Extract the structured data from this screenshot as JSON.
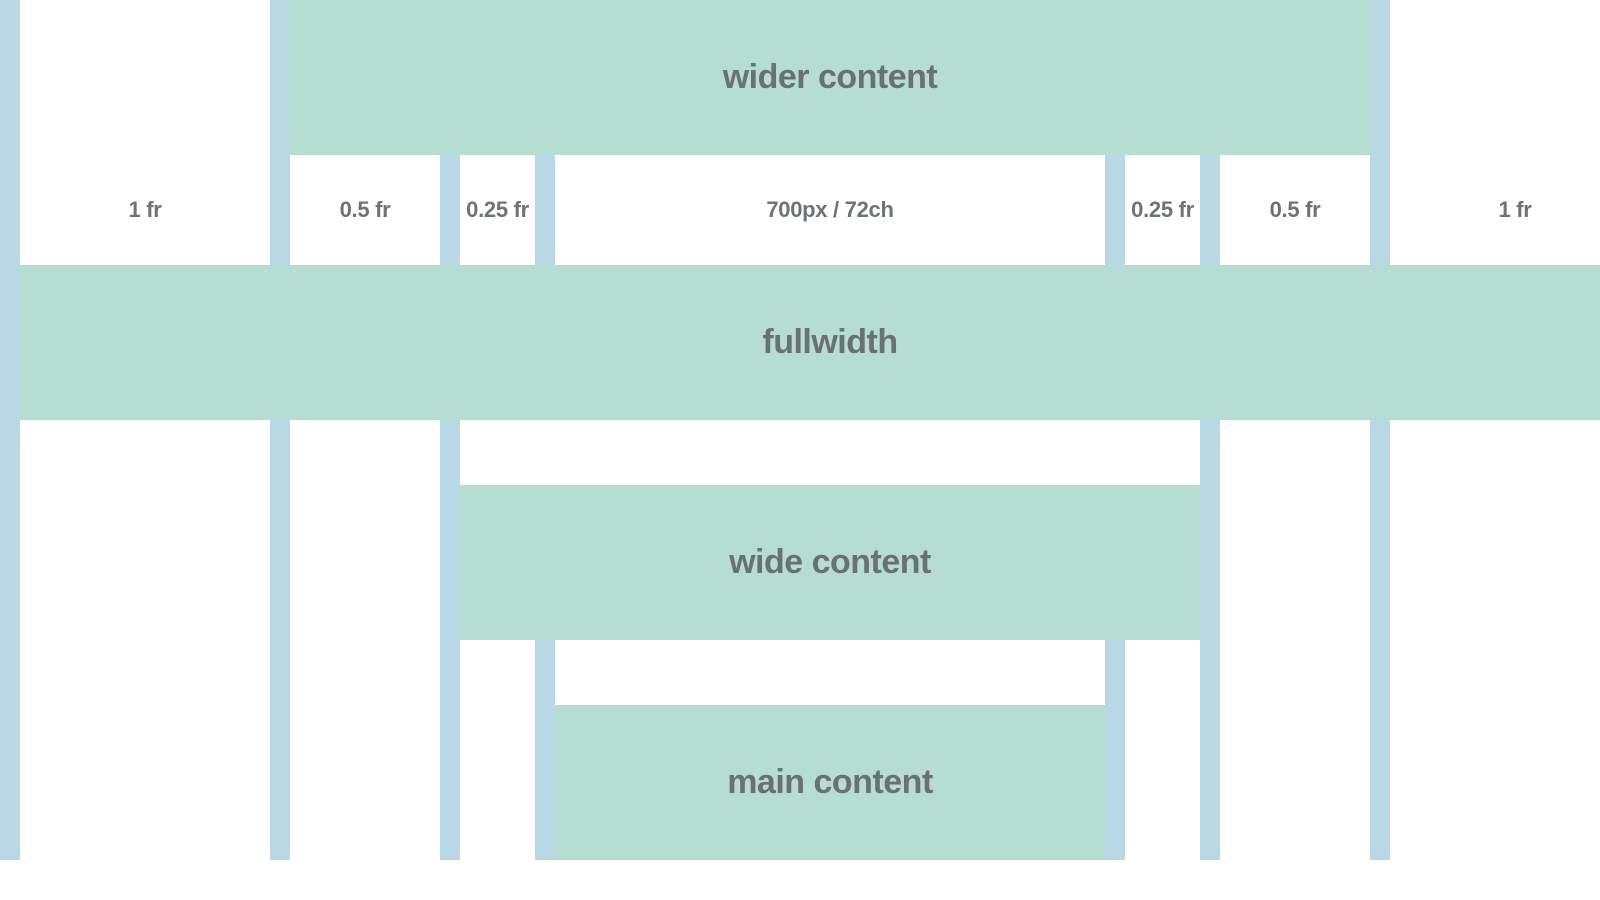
{
  "columns": {
    "left_fr": "1 fr",
    "left_half": "0.5 fr",
    "left_quarter": "0.25 fr",
    "main": "700px / 72ch",
    "right_quarter": "0.25 fr",
    "right_half": "0.5 fr",
    "right_fr": "1 fr"
  },
  "bands": {
    "wider": "wider content",
    "fullwidth": "fullwidth",
    "wide": "wide content",
    "main": "main content"
  },
  "colors": {
    "gutter": "#b8d8e6",
    "band": "#b6ddd1",
    "text": "#6b7073"
  }
}
